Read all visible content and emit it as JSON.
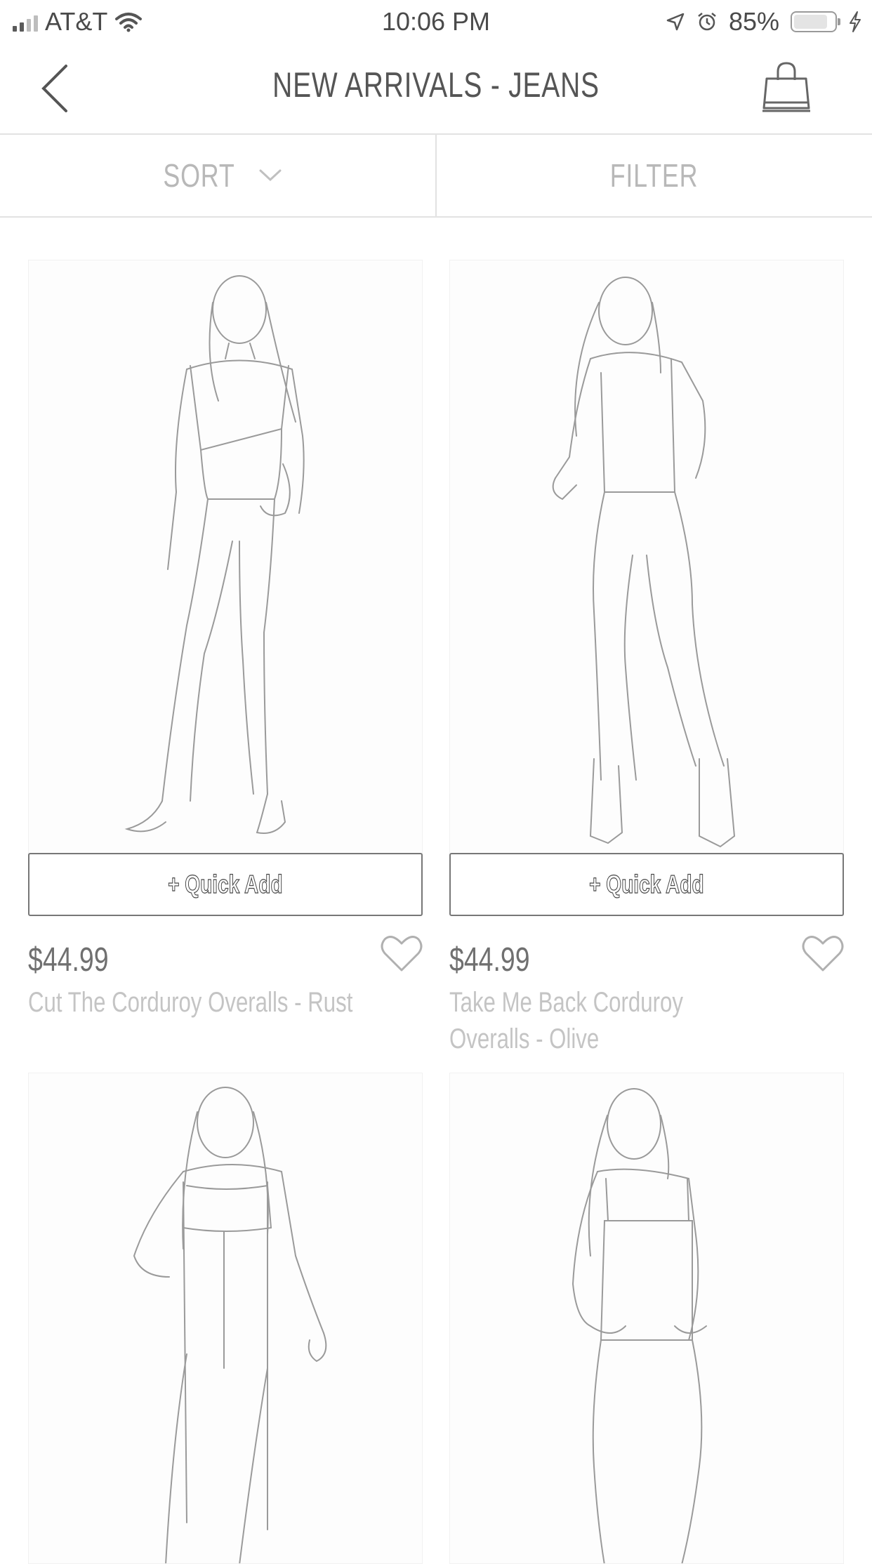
{
  "status_bar": {
    "carrier": "AT&T",
    "time": "10:06 PM",
    "battery": "85%",
    "battery_level": 0.85
  },
  "header": {
    "title": "NEW ARRIVALS - JEANS"
  },
  "toolbar": {
    "sort_label": "SORT",
    "filter_label": "FILTER"
  },
  "products": [
    {
      "quick_add": "+ Quick Add",
      "price": "$44.99",
      "name": "Cut The Corduroy Overalls - Rust"
    },
    {
      "quick_add": "+ Quick Add",
      "price": "$44.99",
      "name": "Take Me Back Corduroy Overalls - Olive"
    },
    {},
    {}
  ],
  "icons": {
    "back": "chevron-left-icon",
    "cart": "shopping-bag-icon",
    "sort": "chevron-down-icon",
    "wishlist": "heart-outline-icon"
  },
  "colors": {
    "text_primary": "#555555",
    "text_muted": "#b8b8b8",
    "divider": "#e2e2e2"
  }
}
